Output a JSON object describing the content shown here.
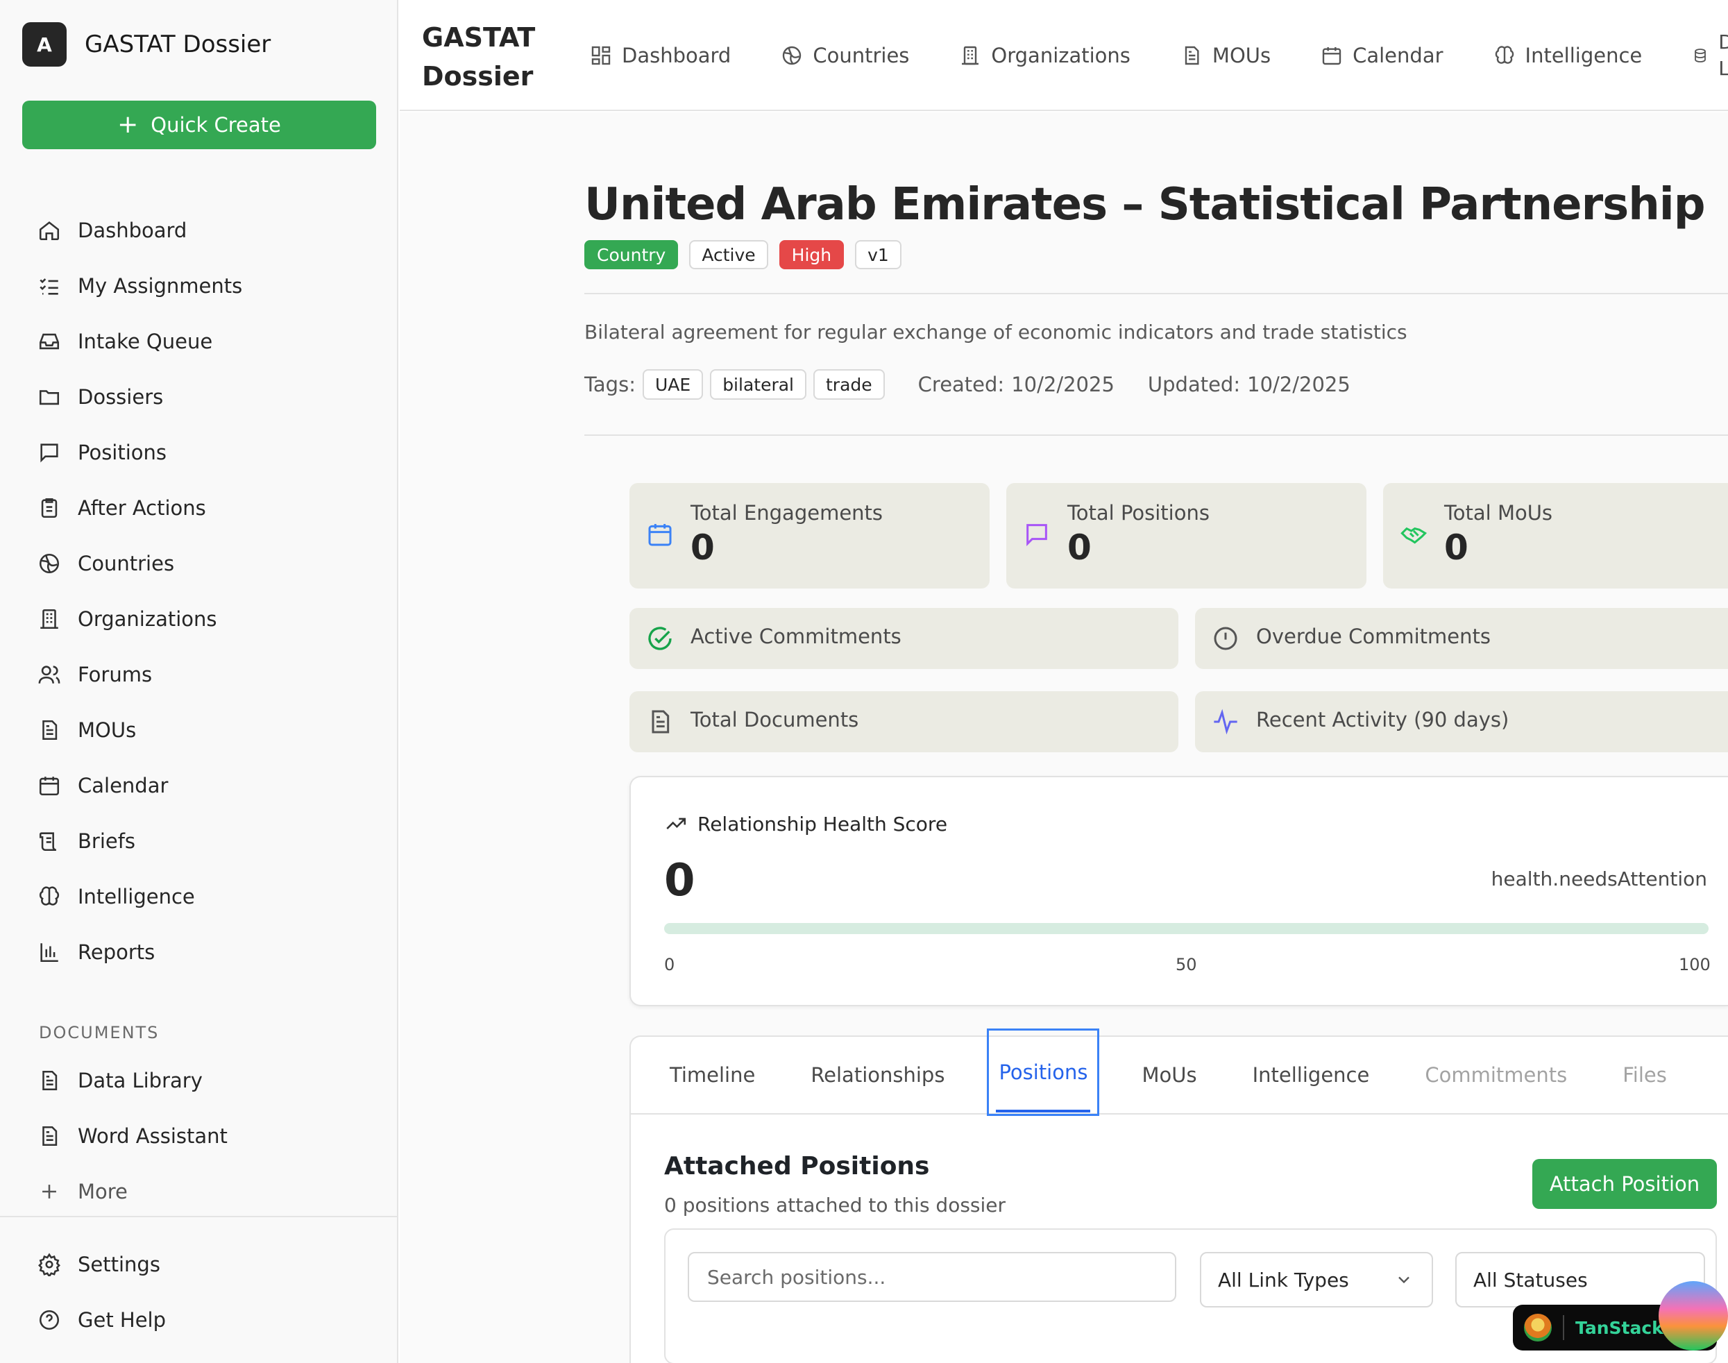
{
  "brand": {
    "avatar_letter": "A",
    "name": "GASTAT Dossier"
  },
  "quick_create": {
    "label": "Quick Create"
  },
  "sidebar": {
    "items": [
      {
        "label": "Dashboard",
        "icon": "home-icon"
      },
      {
        "label": "My Assignments",
        "icon": "list-check-icon"
      },
      {
        "label": "Intake Queue",
        "icon": "inbox-icon"
      },
      {
        "label": "Dossiers",
        "icon": "folder-icon"
      },
      {
        "label": "Positions",
        "icon": "message-square-icon"
      },
      {
        "label": "After Actions",
        "icon": "clipboard-list-icon"
      },
      {
        "label": "Countries",
        "icon": "globe-icon"
      },
      {
        "label": "Organizations",
        "icon": "building-icon"
      },
      {
        "label": "Forums",
        "icon": "users-icon"
      },
      {
        "label": "MOUs",
        "icon": "file-text-icon"
      },
      {
        "label": "Calendar",
        "icon": "calendar-icon"
      },
      {
        "label": "Briefs",
        "icon": "scroll-icon"
      },
      {
        "label": "Intelligence",
        "icon": "brain-icon"
      },
      {
        "label": "Reports",
        "icon": "bar-chart-icon"
      }
    ],
    "documents_label": "DOCUMENTS",
    "documents": [
      {
        "label": "Data Library",
        "icon": "file-text-icon"
      },
      {
        "label": "Word Assistant",
        "icon": "file-text-icon"
      },
      {
        "label": "More",
        "icon": "plus-icon"
      }
    ],
    "bottom": [
      {
        "label": "Settings",
        "icon": "gear-icon"
      },
      {
        "label": "Get Help",
        "icon": "help-circle-icon"
      }
    ]
  },
  "topbar": {
    "title_line1": "GASTAT",
    "title_line2": "Dossier",
    "nav": [
      {
        "label": "Dashboard",
        "icon": "layout-grid-icon"
      },
      {
        "label": "Countries",
        "icon": "globe-icon"
      },
      {
        "label": "Organizations",
        "icon": "building-icon"
      },
      {
        "label": "MOUs",
        "icon": "file-text-icon"
      },
      {
        "label": "Calendar",
        "icon": "calendar-icon"
      },
      {
        "label": "Intelligence",
        "icon": "brain-icon"
      }
    ],
    "nav_cut_line1": "Data",
    "nav_cut_line2": "Libra"
  },
  "dossier": {
    "title": "United Arab Emirates – Statistical Partnership",
    "badges": {
      "type": "Country",
      "status": "Active",
      "priority": "High",
      "version": "v1"
    },
    "description": "Bilateral agreement for regular exchange of economic indicators and trade statistics",
    "tags_label": "Tags:",
    "tags": [
      "UAE",
      "bilateral",
      "trade"
    ],
    "created_label": "Created:",
    "created": "10/2/2025",
    "updated_label": "Updated:",
    "updated": "10/2/2025"
  },
  "stats": {
    "engagements": {
      "label": "Total Engagements",
      "value": "0"
    },
    "positions": {
      "label": "Total Positions",
      "value": "0"
    },
    "mous": {
      "label": "Total MoUs",
      "value": "0"
    },
    "active_commitments": {
      "label": "Active Commitments"
    },
    "overdue_commitments": {
      "label": "Overdue Commitments"
    },
    "documents": {
      "label": "Total Documents"
    },
    "recent_activity": {
      "label": "Recent Activity (90 days)"
    }
  },
  "health": {
    "title": "Relationship Health Score",
    "score": "0",
    "score_fraction": 0,
    "status": "health.needsAttention",
    "ticks": [
      "0",
      "50",
      "100"
    ]
  },
  "tabs": [
    {
      "label": "Timeline",
      "state": "normal"
    },
    {
      "label": "Relationships",
      "state": "normal"
    },
    {
      "label": "Positions",
      "state": "active"
    },
    {
      "label": "MoUs",
      "state": "normal"
    },
    {
      "label": "Intelligence",
      "state": "normal"
    },
    {
      "label": "Commitments",
      "state": "muted"
    },
    {
      "label": "Files",
      "state": "muted"
    }
  ],
  "positions_panel": {
    "title": "Attached Positions",
    "subtitle": "0 positions attached to this dossier",
    "attach_label": "Attach Position",
    "search_placeholder": "Search positions...",
    "link_type_value": "All Link Types",
    "status_value": "All Statuses"
  },
  "devtools": {
    "label": "TanStack"
  },
  "colors": {
    "accent": "#34a853",
    "danger": "#e54848",
    "link": "#2563eb"
  }
}
